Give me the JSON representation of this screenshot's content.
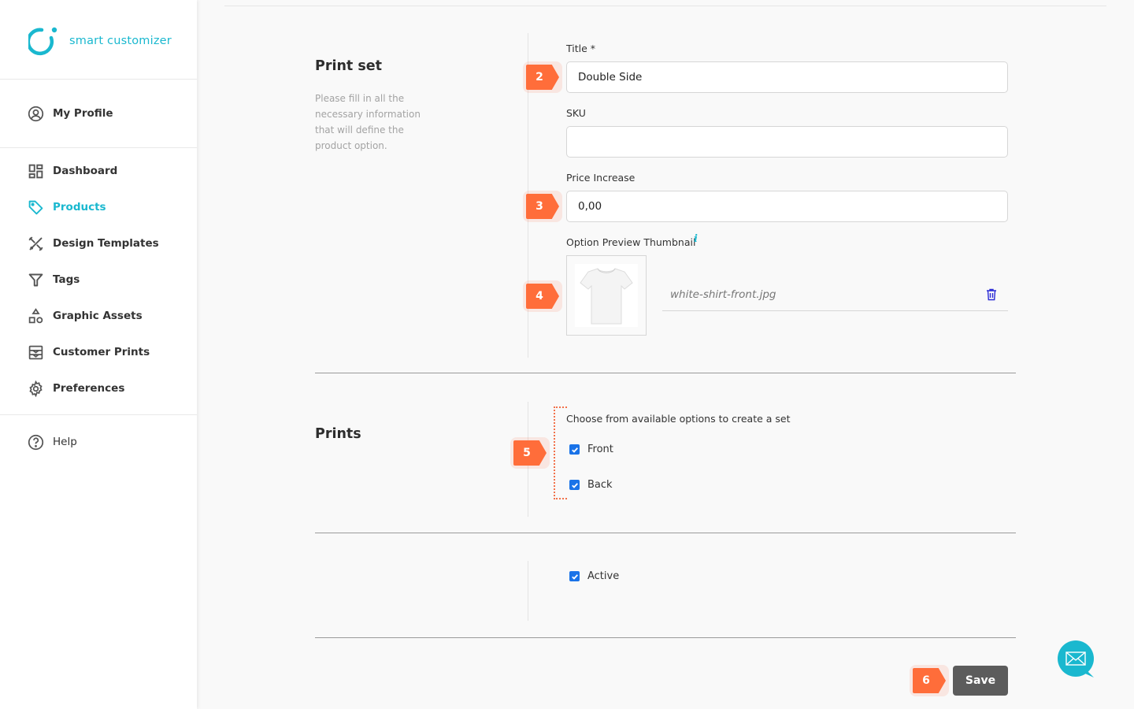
{
  "brand": {
    "name": "smart customizer",
    "accent_color": "#1ab8cf"
  },
  "sidebar": {
    "profile": {
      "label": "My Profile",
      "icon": "user-circle-icon"
    },
    "items": [
      {
        "label": "Dashboard",
        "icon": "dashboard-icon",
        "active": false
      },
      {
        "label": "Products",
        "icon": "tag-icon",
        "active": true
      },
      {
        "label": "Design Templates",
        "icon": "design-tools-icon",
        "active": false
      },
      {
        "label": "Tags",
        "icon": "filter-icon",
        "active": false
      },
      {
        "label": "Graphic Assets",
        "icon": "shapes-icon",
        "active": false
      },
      {
        "label": "Customer Prints",
        "icon": "prints-icon",
        "active": false
      },
      {
        "label": "Preferences",
        "icon": "gear-icon",
        "active": false
      }
    ],
    "help": {
      "label": "Help",
      "icon": "help-circle-icon"
    }
  },
  "print_set": {
    "title": "Print set",
    "description": "Please fill in all the necessary information that will define the product option.",
    "fields": {
      "title": {
        "label": "Title *",
        "value": "Double Side",
        "placeholder": ""
      },
      "sku": {
        "label": "SKU",
        "value": "",
        "placeholder": ""
      },
      "price_increase": {
        "label": "Price Increase",
        "value": "0,00",
        "placeholder": ""
      },
      "thumbnail": {
        "label": "Option Preview Thumbnail",
        "info_icon": "i",
        "file_name": "white-shirt-front.jpg"
      }
    }
  },
  "prints": {
    "title": "Prints",
    "instruction": "Choose from available options to create a set",
    "options": [
      {
        "label": "Front",
        "checked": true
      },
      {
        "label": "Back",
        "checked": true
      }
    ]
  },
  "status": {
    "active": {
      "label": "Active",
      "checked": true
    }
  },
  "actions": {
    "save_label": "Save"
  },
  "step_badges": [
    "2",
    "3",
    "4",
    "5",
    "6"
  ],
  "badge_color": "#ff6d3a"
}
